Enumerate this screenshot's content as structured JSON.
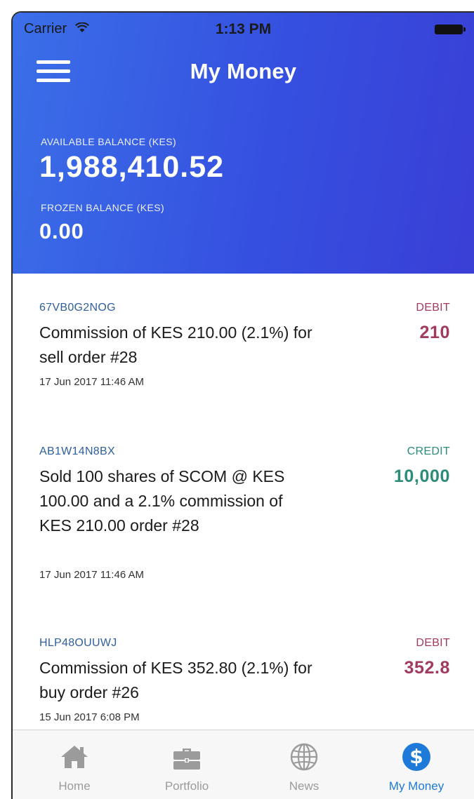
{
  "status_bar": {
    "carrier": "Carrier",
    "time": "1:13 PM"
  },
  "header": {
    "title": "My Money",
    "available_label": "AVAILABLE BALANCE (KES)",
    "available_value": "1,988,410.52",
    "frozen_label": "FROZEN BALANCE (KES)",
    "frozen_value": "0.00"
  },
  "transactions": [
    {
      "id": "67VB0G2NOG",
      "description": "Commission of KES 210.00 (2.1%) for sell order #28",
      "date": "17 Jun 2017 11:46 AM",
      "type": "DEBIT",
      "amount": "210"
    },
    {
      "id": "AB1W14N8BX",
      "description": "Sold 100 shares of SCOM @ KES 100.00 and a 2.1% commission of KES 210.00 order #28",
      "date": "17 Jun 2017 11:46 AM",
      "type": "CREDIT",
      "amount": "10,000"
    },
    {
      "id": "HLP48OUUWJ",
      "description": "Commission of KES 352.80 (2.1%) for buy order #26",
      "date": "15 Jun 2017 6:08 PM",
      "type": "DEBIT",
      "amount": "352.8"
    }
  ],
  "colors": {
    "header_gradient_start": "#3b6fe8",
    "header_gradient_end": "#3a3fd6",
    "debit": "#a13a5c",
    "credit": "#2b8c7a",
    "tab_active": "#1e7ad9",
    "tab_inactive": "#9b9b9b"
  },
  "tab_bar": {
    "tabs": [
      {
        "label": "Home",
        "icon": "home-icon",
        "active": false
      },
      {
        "label": "Portfolio",
        "icon": "briefcase-icon",
        "active": false
      },
      {
        "label": "News",
        "icon": "globe-icon",
        "active": false
      },
      {
        "label": "My Money",
        "icon": "dollar-icon",
        "active": true
      }
    ]
  }
}
